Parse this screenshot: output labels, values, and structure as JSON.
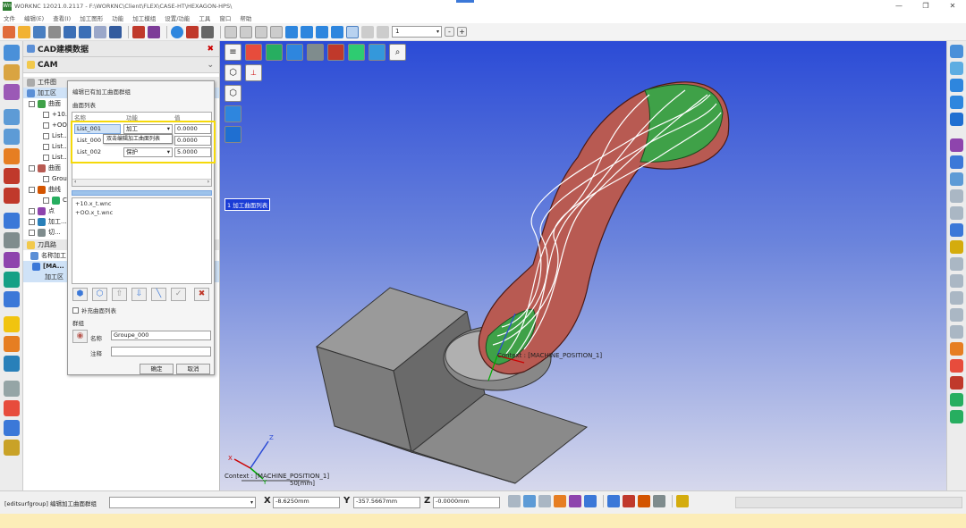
{
  "window": {
    "title": "WORKNC 12021.0.2117 - F:\\WORKNC\\Client\\FLEX\\CASE-HT\\HEXAGON-HPS\\",
    "logo": "Wn"
  },
  "menu": [
    "文件",
    "编辑(E)",
    "查看(I)",
    "加工图形",
    "功能",
    "加工模组",
    "设置/功能",
    "工具",
    "窗口",
    "帮助"
  ],
  "toolbar": {
    "layer_value": "1",
    "minus": "-",
    "plus": "+"
  },
  "panel": {
    "cad_title": "CAD建模数据",
    "cam_title": "CAM",
    "tree": [
      "工件图",
      "加工区",
      "曲面",
      "+10...",
      "+OO...",
      "List...",
      "List...",
      "List...",
      "曲面",
      "Grou...",
      "曲线",
      "C...",
      "点",
      "加工...",
      "切...",
      "刀具路",
      "名称加工",
      "[MA...",
      "加工区"
    ]
  },
  "dialog": {
    "title": "编辑已有加工曲面群组",
    "section": "曲面列表",
    "cols": [
      "名称",
      "功能",
      "值"
    ],
    "rows": [
      {
        "name": "List_001",
        "func": "加工",
        "val": "0.0000"
      },
      {
        "name": "List_000",
        "func": "",
        "val": "0.0000"
      },
      {
        "name": "List_002",
        "func": "保护",
        "val": "5.0000"
      }
    ],
    "tooltip": "双击编辑加工曲面列表",
    "files": [
      "+10.x_t.wnc",
      "+OO.x_t.wnc"
    ],
    "extra_check": "补充曲面列表",
    "group_label": "群组",
    "name_label": "名称",
    "name_value": "Groupe_000",
    "note_label": "注释",
    "ok": "确定",
    "cancel": "取消"
  },
  "viewport": {
    "list_label": "1 加工曲面列表",
    "context_model": "Context : [MACHINE_POSITION_1]",
    "context_triad": "Context : [MACHINE_POSITION_1]",
    "scale": "50[mm]",
    "axis_x": "X",
    "axis_y": "Y",
    "axis_z": "Z",
    "menu_icon": "≡"
  },
  "status": {
    "command": "[editsurfgroup] 编辑加工曲面群组",
    "x_label": "X",
    "x_value": "-8.6250mm",
    "y_label": "Y",
    "y_value": "-357.5667mm",
    "z_label": "Z",
    "z_value": "-0.0000mm"
  },
  "colors": {
    "accent": "#2b4bd6",
    "highlight": "#f5d90a",
    "model_red": "#b85a52",
    "model_green": "#3fa148",
    "block_gray": "#8a8a8a"
  }
}
